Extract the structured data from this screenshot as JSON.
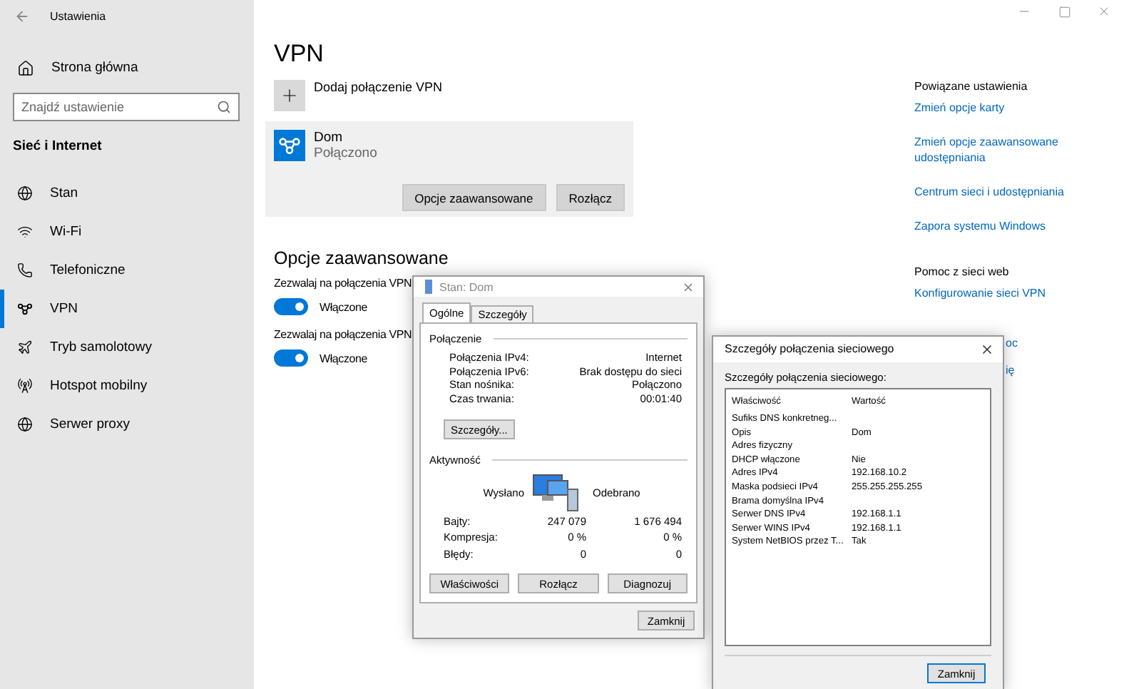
{
  "window": {
    "title": "Ustawienia"
  },
  "sidebar": {
    "home": "Strona główna",
    "search": {
      "placeholder": "Znajdź ustawienie"
    },
    "section": "Sieć i Internet",
    "items": [
      {
        "label": "Stan",
        "selected": false
      },
      {
        "label": "Wi-Fi",
        "selected": false
      },
      {
        "label": "Telefoniczne",
        "selected": false
      },
      {
        "label": "VPN",
        "selected": true
      },
      {
        "label": "Tryb samolotowy",
        "selected": false
      },
      {
        "label": "Hotspot mobilny",
        "selected": false
      },
      {
        "label": "Serwer proxy",
        "selected": false
      }
    ]
  },
  "main": {
    "title": "VPN",
    "add": "Dodaj połączenie VPN",
    "connection": {
      "name": "Dom",
      "status": "Połączono",
      "buttons": [
        "Opcje zaawansowane",
        "Rozłącz"
      ]
    },
    "advanced_title": "Opcje zaawansowane",
    "toggles": [
      {
        "label": "Zezwalaj na połączenia VPN",
        "on": true,
        "state": "Włączone"
      },
      {
        "label": "Zezwalaj na połączenia VPN",
        "on": true,
        "state": "Włączone"
      }
    ]
  },
  "related": {
    "title": "Powiązane ustawienia",
    "links": [
      "Zmień opcje karty",
      "Zmień opcje zaawansowane udostępniania",
      "Centrum sieci i udostępniania",
      "Zapora systemu Windows"
    ],
    "help_title": "Pomoc z sieci web",
    "help_links": [
      "Konfigurowanie sieci VPN"
    ],
    "partial_links": [
      "oc",
      "ię"
    ]
  },
  "status_dialog": {
    "title": "Stan: Dom",
    "tabs": [
      {
        "label": "Ogólne",
        "selected": true
      },
      {
        "label": "Szczegóły",
        "selected": false
      }
    ],
    "connection_group": "Połączenie",
    "rows": [
      {
        "label": "Połączenia IPv4:",
        "value": "Internet"
      },
      {
        "label": "Połączenia IPv6:",
        "value": "Brak dostępu do sieci"
      },
      {
        "label": "Stan nośnika:",
        "value": "Połączono"
      },
      {
        "label": "Czas trwania:",
        "value": "00:01:40"
      }
    ],
    "details_button": "Szczegóły...",
    "activity_group": "Aktywność",
    "sent": "Wysłano",
    "received": "Odebrano",
    "stats": [
      {
        "label": "Bajty:",
        "sent": "247 079",
        "received": "1 676 494"
      },
      {
        "label": "Kompresja:",
        "sent": "0 %",
        "received": "0 %"
      },
      {
        "label": "Błędy:",
        "sent": "0",
        "received": "0"
      }
    ],
    "buttons": [
      "Właściwości",
      "Rozłącz",
      "Diagnozuj"
    ],
    "close": "Zamknij"
  },
  "details_dialog": {
    "title": "Szczegóły połączenia sieciowego",
    "label": "Szczegóły połączenia sieciowego:",
    "columns": [
      "Właściwość",
      "Wartość"
    ],
    "rows": [
      [
        "Sufiks DNS konkretneg...",
        ""
      ],
      [
        "Opis",
        "Dom"
      ],
      [
        "Adres fizyczny",
        ""
      ],
      [
        "DHCP włączone",
        "Nie"
      ],
      [
        "Adres IPv4",
        "192.168.10.2"
      ],
      [
        "Maska podsieci IPv4",
        "255.255.255.255"
      ],
      [
        "Brama domyślna IPv4",
        ""
      ],
      [
        "Serwer DNS IPv4",
        "192.168.1.1"
      ],
      [
        "Serwer WINS IPv4",
        "192.168.1.1"
      ],
      [
        "System NetBIOS przez T...",
        "Tak"
      ]
    ],
    "close": "Zamknij"
  }
}
